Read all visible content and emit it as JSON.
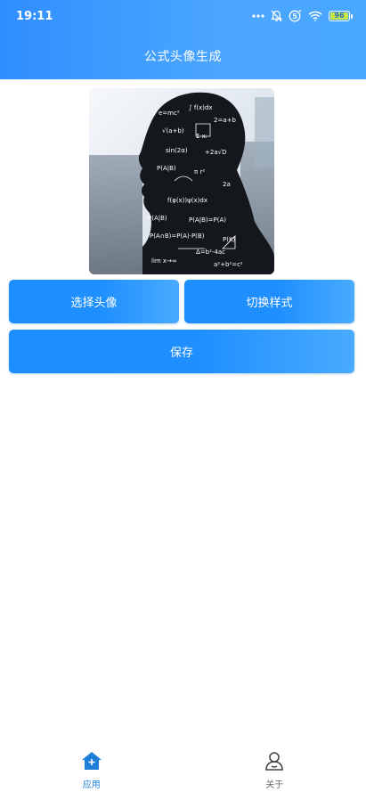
{
  "status_bar": {
    "time": "19:11",
    "battery": "96",
    "icons": [
      "more-dots-icon",
      "bell-muted-icon",
      "5g-icon",
      "wifi-icon",
      "battery-icon"
    ]
  },
  "header": {
    "title": "公式头像生成",
    "gradient_start": "#2f8eff",
    "gradient_end": "#4aa7ff"
  },
  "avatar": {
    "description_icon": "formula-avatar-image"
  },
  "actions": {
    "choose_label": "选择头像",
    "switch_label": "切换样式",
    "save_label": "保存",
    "button_color": "#1e8eff"
  },
  "tab_bar": {
    "items": [
      {
        "label": "应用",
        "icon": "home-icon",
        "active": true
      },
      {
        "label": "关于",
        "icon": "user-icon",
        "active": false
      }
    ],
    "active_color": "#1e7fd8",
    "inactive_color": "#666666"
  }
}
